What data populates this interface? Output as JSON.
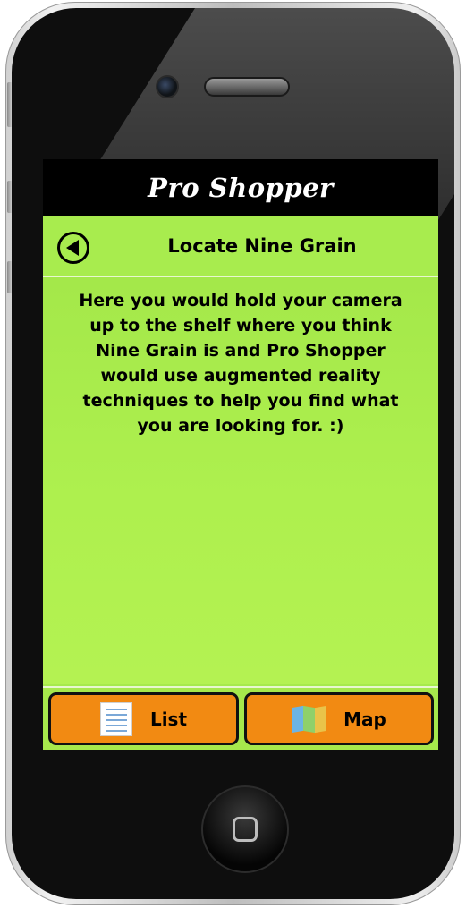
{
  "app": {
    "title": "Pro Shopper"
  },
  "nav": {
    "title": "Locate Nine Grain",
    "back_icon": "back-arrow-icon"
  },
  "content": {
    "message": "Here you would hold your camera up to the shelf where you think Nine Grain is and Pro Shopper would use augmented reality techniques to help you find what you are looking for. :)"
  },
  "toolbar": {
    "list_label": "List",
    "list_icon": "list-icon",
    "map_label": "Map",
    "map_icon": "map-icon"
  },
  "colors": {
    "screen_green": "#a6ea4c",
    "header_black": "#000000",
    "button_orange": "#f28a12",
    "phone_body": "#0e0e0e"
  }
}
